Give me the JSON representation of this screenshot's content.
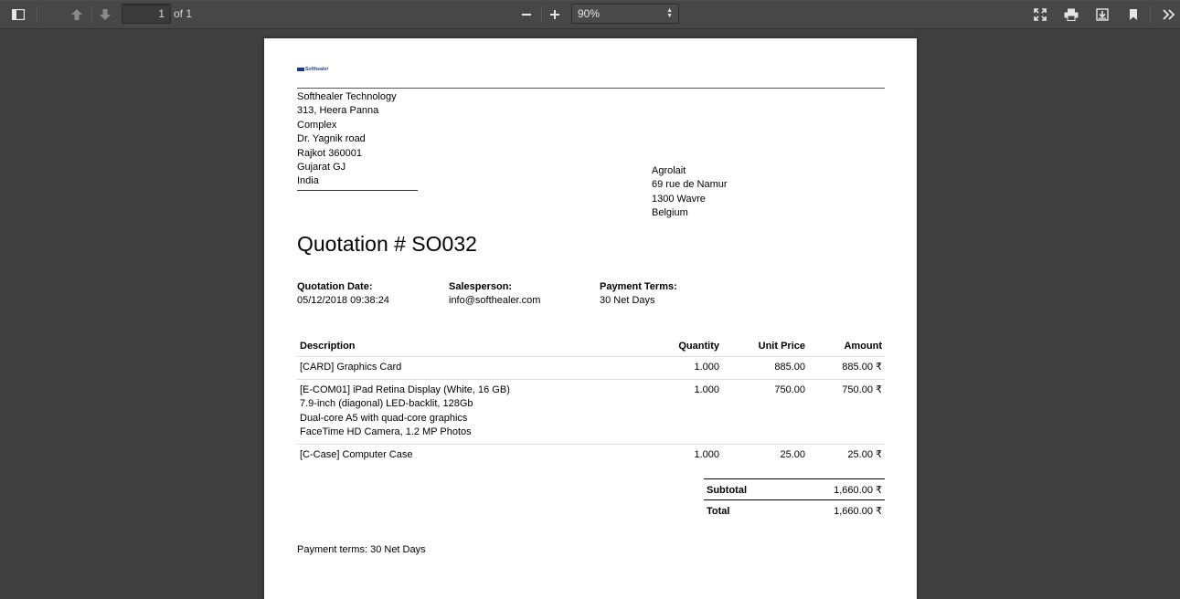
{
  "toolbar": {
    "page_number": "1",
    "page_count": "of 1",
    "zoom": "90%"
  },
  "document": {
    "logo_text": "Softhealer",
    "company": {
      "name": "Softhealer Technology",
      "line1": "313, Heera Panna Complex",
      "line2": "Dr. Yagnik road",
      "line3": "Rajkot 360001",
      "line4": "Gujarat GJ",
      "line5": "India"
    },
    "customer": {
      "name": "Agrolait",
      "line1": "69 rue de Namur",
      "line2": "1300 Wavre",
      "line3": "Belgium"
    },
    "title": "Quotation # SO032",
    "info": {
      "date_label": "Quotation Date:",
      "date_value": "05/12/2018 09:38:24",
      "salesperson_label": "Salesperson:",
      "salesperson_value": "info@softhealer.com",
      "terms_label": "Payment Terms:",
      "terms_value": "30 Net Days"
    },
    "table": {
      "headers": {
        "description": "Description",
        "quantity": "Quantity",
        "unit_price": "Unit Price",
        "amount": "Amount"
      },
      "rows": [
        {
          "description": [
            "[CARD] Graphics Card"
          ],
          "quantity": "1.000",
          "unit_price": "885.00",
          "amount": "885.00 ₹"
        },
        {
          "description": [
            "[E-COM01] iPad Retina Display (White, 16 GB)",
            "7.9-inch (diagonal) LED-backlit, 128Gb",
            "Dual-core A5 with quad-core graphics",
            "FaceTime HD Camera, 1.2 MP Photos"
          ],
          "quantity": "1.000",
          "unit_price": "750.00",
          "amount": "750.00 ₹"
        },
        {
          "description": [
            "[C-Case] Computer Case"
          ],
          "quantity": "1.000",
          "unit_price": "25.00",
          "amount": "25.00 ₹"
        }
      ]
    },
    "totals": {
      "subtotal_label": "Subtotal",
      "subtotal_value": "1,660.00 ₹",
      "total_label": "Total",
      "total_value": "1,660.00 ₹"
    },
    "payment_terms_note": "Payment terms: 30 Net Days"
  }
}
